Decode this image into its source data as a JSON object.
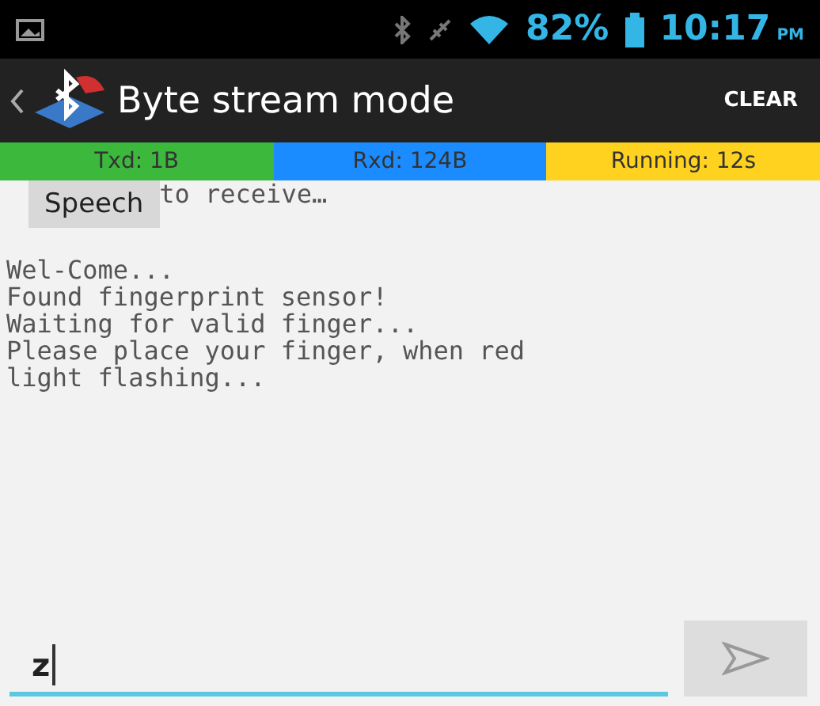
{
  "status_bar": {
    "battery": "82%",
    "time": "10:17",
    "ampm": "PM"
  },
  "action_bar": {
    "title": "Byte stream mode",
    "action": "CLEAR"
  },
  "counters": [
    {
      "label": "Txd: 1B",
      "color": "#3cb83c"
    },
    {
      "label": "Rxd: 124B",
      "color": "#1a8cff"
    },
    {
      "label": "Running: 12s",
      "color": "#ffd21f"
    }
  ],
  "speech_button": "Speech",
  "first_line": "to receive…",
  "log": [
    "Wel-Come...",
    "Found fingerprint sensor!",
    "Waiting for valid finger...",
    "Please place your finger, when red",
    "light flashing..."
  ],
  "input": {
    "value": "z"
  }
}
